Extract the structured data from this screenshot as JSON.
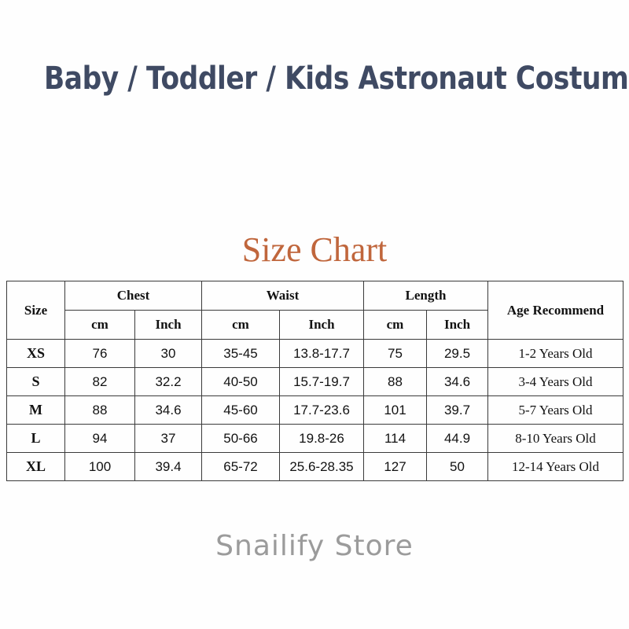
{
  "product_title": "Baby / Toddler / Kids Astronaut  Costume",
  "chart_heading": "Size Chart",
  "watermark": "Snailify Store",
  "colors": {
    "title": "#3f4a63",
    "heading": "#c0663c",
    "table_border": "#3a3a3a",
    "table_text": "#121212",
    "watermark": "#9b9b9b",
    "background": "#fefefe"
  },
  "chart_data": {
    "type": "table",
    "title": "Size Chart",
    "group_headers": [
      "Size",
      "Chest",
      "Waist",
      "Length",
      "Age Recommend"
    ],
    "unit_headers": {
      "chest_cm": "cm",
      "chest_inch": "Inch",
      "waist_cm": "cm",
      "waist_inch": "Inch",
      "length_cm": "cm",
      "length_inch": "Inch"
    },
    "columns": [
      "Size",
      "Chest cm",
      "Chest Inch",
      "Waist cm",
      "Waist Inch",
      "Length cm",
      "Length Inch",
      "Age Recommend"
    ],
    "rows": [
      {
        "size": "XS",
        "chest_cm": "76",
        "chest_inch": "30",
        "waist_cm": "35-45",
        "waist_inch": "13.8-17.7",
        "length_cm": "75",
        "length_inch": "29.5",
        "age": "1-2 Years Old"
      },
      {
        "size": "S",
        "chest_cm": "82",
        "chest_inch": "32.2",
        "waist_cm": "40-50",
        "waist_inch": "15.7-19.7",
        "length_cm": "88",
        "length_inch": "34.6",
        "age": "3-4 Years Old"
      },
      {
        "size": "M",
        "chest_cm": "88",
        "chest_inch": "34.6",
        "waist_cm": "45-60",
        "waist_inch": "17.7-23.6",
        "length_cm": "101",
        "length_inch": "39.7",
        "age": "5-7 Years Old"
      },
      {
        "size": "L",
        "chest_cm": "94",
        "chest_inch": "37",
        "waist_cm": "50-66",
        "waist_inch": "19.8-26",
        "length_cm": "114",
        "length_inch": "44.9",
        "age": "8-10 Years Old"
      },
      {
        "size": "XL",
        "chest_cm": "100",
        "chest_inch": "39.4",
        "waist_cm": "65-72",
        "waist_inch": "25.6-28.35",
        "length_cm": "127",
        "length_inch": "50",
        "age": "12-14 Years Old"
      }
    ]
  }
}
